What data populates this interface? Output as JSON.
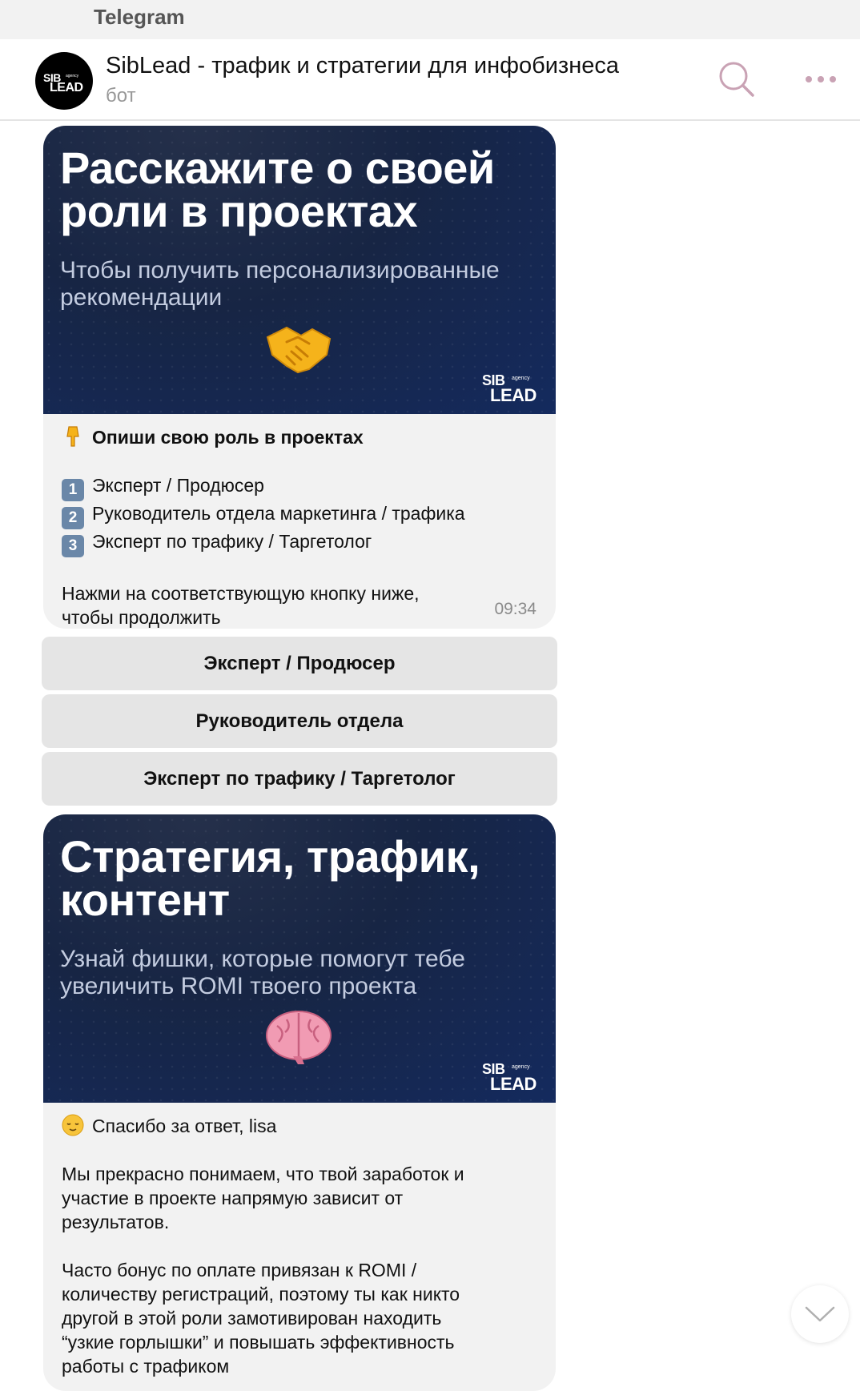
{
  "app": {
    "title": "Telegram"
  },
  "header": {
    "chat_title": "SibLead - трафик и стратегии для инфобизнеса",
    "subtitle": "бот",
    "icons": [
      "search-icon",
      "more-icon"
    ]
  },
  "logo": {
    "sib": "SIB",
    "lead": "LEAD",
    "agency": "agency"
  },
  "messages": [
    {
      "promo_title": "Расскажите о своей роли в проектах",
      "promo_subtitle": "Чтобы получить персонализированные рекомендации",
      "promo_emoji": "handshake",
      "heading": "Опиши свою роль в проектах",
      "heading_emoji": "pointing-down",
      "options": [
        {
          "num": "1",
          "text": "Эксперт / Продюсер"
        },
        {
          "num": "2",
          "text": "Руководитель отдела маркетинга / трафика"
        },
        {
          "num": "3",
          "text": "Эксперт по трафику / Таргетолог"
        }
      ],
      "footer_lines": [
        "Нажми на соответствующую кнопку ниже,",
        "чтобы продолжить"
      ],
      "time": "09:34"
    },
    {
      "promo_title": "Стратегия, трафик, контент",
      "promo_subtitle": "Узнай фишки, которые помогут тебе увеличить ROMI твоего проекта",
      "promo_emoji": "brain",
      "greeting": "Спасибо за ответ, lisa",
      "greeting_emoji": "relieved-face",
      "para1_lines": [
        "Мы прекрасно понимаем, что твой заработок и",
        "участие в проекте напрямую зависит от",
        "результатов."
      ],
      "para2_lines": [
        "Часто бонус по оплате привязан к ROMI /",
        "количеству регистраций, поэтому ты как никто",
        "другой в этой роли замотивирован находить",
        "“узкие горлышки” и повышать эффективность",
        "работы с трафиком"
      ]
    }
  ],
  "keyboard": {
    "buttons": [
      "Эксперт / Продюсер",
      "Руководитель отдела",
      "Эксперт по трафику / Таргетолог"
    ]
  },
  "colors": {
    "promo_bg": "#172544",
    "bubble_bg": "#f2f2f2",
    "button_bg": "#e5e5e5",
    "header_icon": "#c9a2b4",
    "timestamp": "#8a8a8a"
  }
}
